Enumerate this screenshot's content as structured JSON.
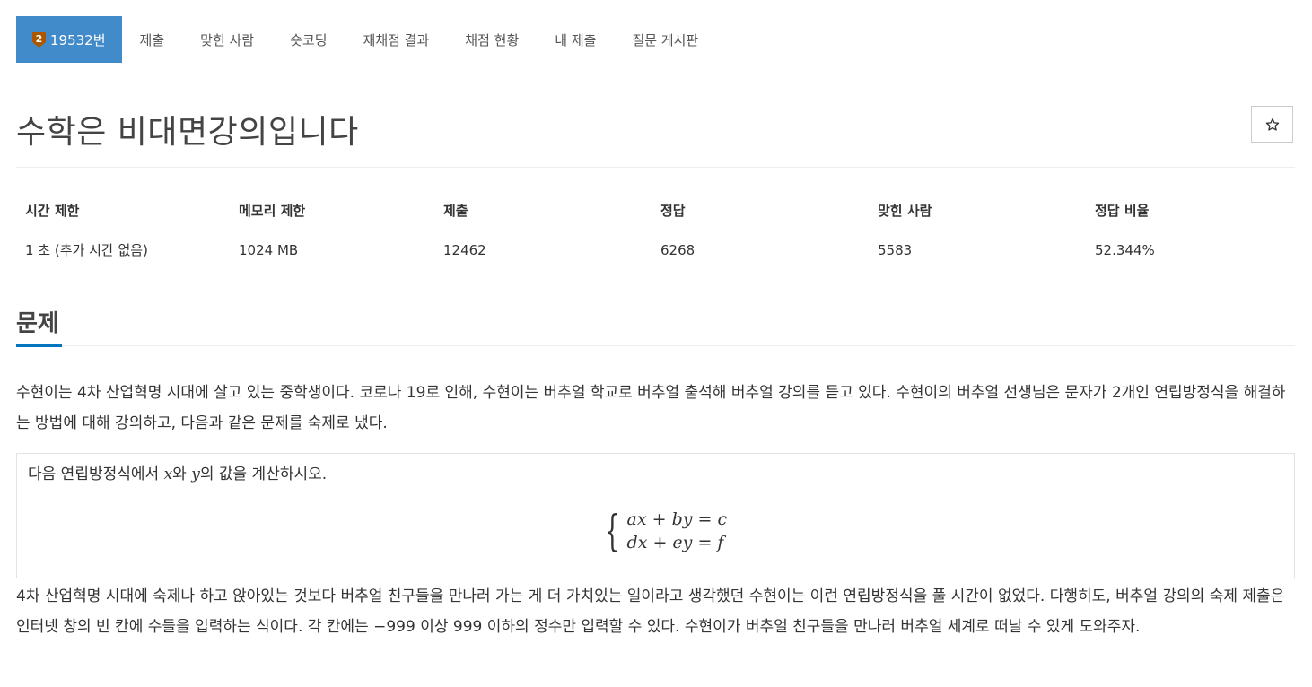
{
  "nav": {
    "problem_tab": "19532번",
    "tier_badge_digit": "2",
    "tier_badge_color": "#ad5600",
    "active_tab_color": "#428bca",
    "items": [
      "제출",
      "맞힌 사람",
      "숏코딩",
      "재채점 결과",
      "채점 현황",
      "내 제출",
      "질문 게시판"
    ]
  },
  "problem": {
    "title": "수학은 비대면강의입니다",
    "star_icon": "star-outline-icon"
  },
  "info": {
    "headers": [
      "시간 제한",
      "메모리 제한",
      "제출",
      "정답",
      "맞힌 사람",
      "정답 비율"
    ],
    "values": [
      "1 초 (추가 시간 없음)",
      "1024 MB",
      "12462",
      "6268",
      "5583",
      "52.344%"
    ]
  },
  "section": {
    "heading": "문제",
    "accent_color": "#0076c0"
  },
  "content": {
    "para1": "수현이는 4차 산업혁명 시대에 살고 있는 중학생이다. 코로나 19로 인해, 수현이는 버추얼 학교로 버추얼 출석해 버추얼 강의를 듣고 있다. 수현이의 버추얼 선생님은 문자가 2개인 연립방정식을 해결하는 방법에 대해 강의하고, 다음과 같은 문제를 숙제로 냈다.",
    "box_prefix": "다음 연립방정식에서 ",
    "var_x": "x",
    "box_middle": "와 ",
    "var_y": "y",
    "box_suffix": "의 값을 계산하시오.",
    "eq1": "ax + by = c",
    "eq2": "dx + ey = f",
    "para2": "4차 산업혁명 시대에 숙제나 하고 앉아있는 것보다 버추얼 친구들을 만나러 가는 게 더 가치있는 일이라고 생각했던 수현이는 이런 연립방정식을 풀 시간이 없었다. 다행히도, 버추얼 강의의 숙제 제출은 인터넷 창의 빈 칸에 수들을 입력하는 식이다. 각 칸에는 −999 이상 999 이하의 정수만 입력할 수 있다. 수현이가 버추얼 친구들을 만나러 버추얼 세계로 떠날 수 있게 도와주자."
  }
}
